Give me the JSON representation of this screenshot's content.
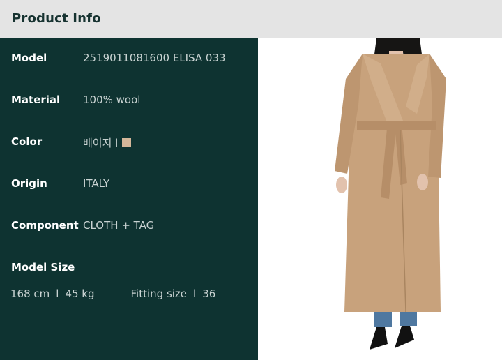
{
  "header": {
    "title": "Product Info"
  },
  "specs": {
    "model": {
      "label": "Model",
      "value": "2519011081600 ELISA 033"
    },
    "material": {
      "label": "Material",
      "value": "100% wool"
    },
    "color": {
      "label": "Color",
      "value": "베이지 l",
      "swatch": "#d4b79a"
    },
    "origin": {
      "label": "Origin",
      "value": "ITALY"
    },
    "component": {
      "label": "Component",
      "value": "CLOTH + TAG"
    }
  },
  "model_size": {
    "label": "Model Size",
    "height": "168 cm",
    "separator": "l",
    "weight": "45 kg",
    "fitting_label": "Fitting size",
    "fitting_separator": "l",
    "fitting_value": "36"
  },
  "colors": {
    "header_bg": "#e4e4e4",
    "panel_bg": "#0e3331",
    "coat": "#c8a27c"
  }
}
